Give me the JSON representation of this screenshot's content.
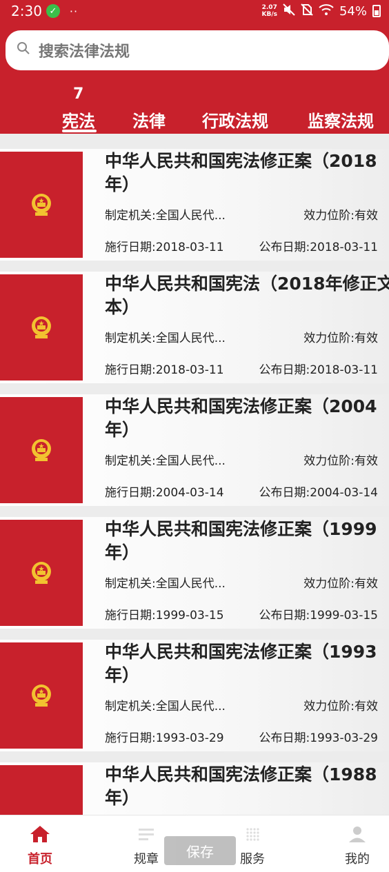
{
  "status_bar": {
    "time": "2:30",
    "net_speed_value": "2.07",
    "net_speed_unit": "KB/s",
    "battery": "54%"
  },
  "search": {
    "placeholder": "搜索法律法规"
  },
  "tab_count": "7",
  "tabs": [
    {
      "label": "宪法",
      "active": true
    },
    {
      "label": "法律",
      "active": false
    },
    {
      "label": "行政法规",
      "active": false
    },
    {
      "label": "监察法规",
      "active": false
    }
  ],
  "laws": [
    {
      "title": "中华人民共和国宪法修正案（2018",
      "title2": "年）",
      "authority": "制定机关:全国人民代...",
      "status": "效力位阶:有效",
      "effective": "施行日期:2018-03-11",
      "published": "公布日期:2018-03-11"
    },
    {
      "title": "中华人民共和国宪法（2018年修正文",
      "title2": "本）",
      "authority": "制定机关:全国人民代...",
      "status": "效力位阶:有效",
      "effective": "施行日期:2018-03-11",
      "published": "公布日期:2018-03-11"
    },
    {
      "title": "中华人民共和国宪法修正案（2004",
      "title2": "年）",
      "authority": "制定机关:全国人民代...",
      "status": "效力位阶:有效",
      "effective": "施行日期:2004-03-14",
      "published": "公布日期:2004-03-14"
    },
    {
      "title": "中华人民共和国宪法修正案（1999",
      "title2": "年）",
      "authority": "制定机关:全国人民代...",
      "status": "效力位阶:有效",
      "effective": "施行日期:1999-03-15",
      "published": "公布日期:1999-03-15"
    },
    {
      "title": "中华人民共和国宪法修正案（1993",
      "title2": "年）",
      "authority": "制定机关:全国人民代...",
      "status": "效力位阶:有效",
      "effective": "施行日期:1993-03-29",
      "published": "公布日期:1993-03-29"
    },
    {
      "title": "中华人民共和国宪法修正案（1988",
      "title2": "年）"
    }
  ],
  "bottom_nav": {
    "home": "首页",
    "rules": "规章",
    "save": "保存",
    "services": "服务",
    "mine": "我的"
  },
  "colors": {
    "brand_red": "#c8212c",
    "emblem_gold": "#f2c230"
  }
}
